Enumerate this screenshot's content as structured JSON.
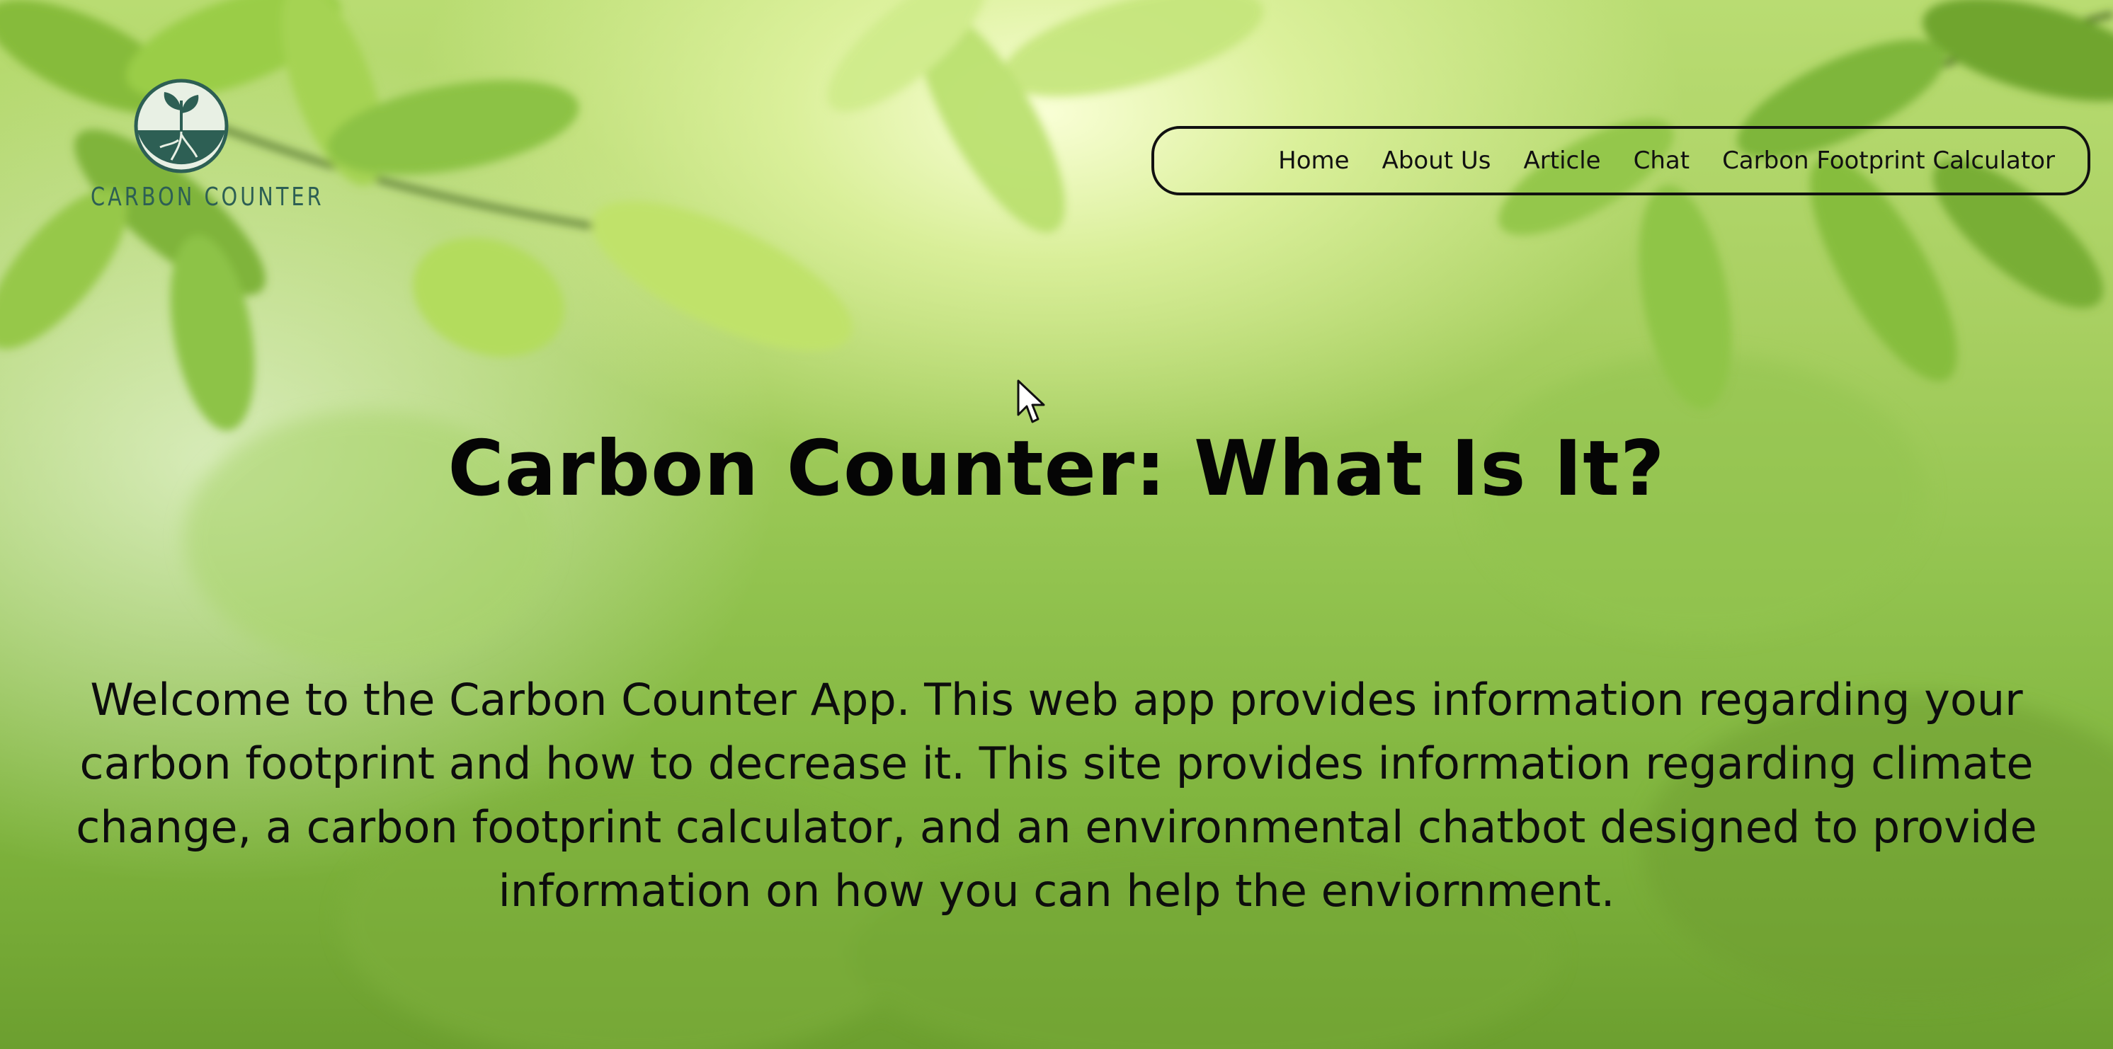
{
  "logo": {
    "text": "CARBON COUNTER",
    "icon": "sprout-roots-icon",
    "colors": {
      "primary": "#2d5f54",
      "light": "#e8f0e4"
    }
  },
  "nav": {
    "items": [
      {
        "label": "Home"
      },
      {
        "label": "About Us"
      },
      {
        "label": "Article"
      },
      {
        "label": "Chat"
      },
      {
        "label": "Carbon Footprint Calculator"
      }
    ]
  },
  "hero": {
    "title": "Carbon Counter: What Is It?",
    "intro": "Welcome to the Carbon Counter App. This web app provides information regarding your carbon footprint and how to decrease it. This site provides information regarding climate change, a carbon footprint calculator, and an environmental chatbot designed to provide information on how you can help the enviornment."
  },
  "theme": {
    "background": "green-leaves-photo",
    "text_color": "#0d0d0d",
    "nav_border": "#111111"
  }
}
